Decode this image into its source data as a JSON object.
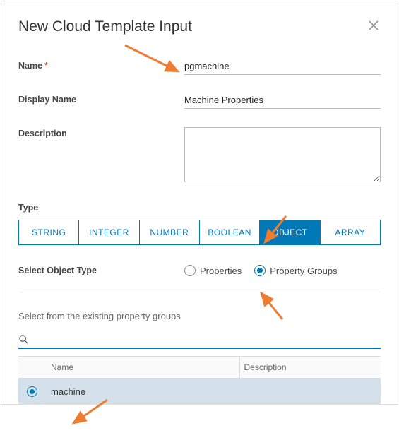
{
  "dialog": {
    "title": "New Cloud Template Input"
  },
  "form": {
    "name_label": "Name",
    "name_value": "pgmachine",
    "display_name_label": "Display Name",
    "display_name_value": "Machine Properties",
    "description_label": "Description",
    "description_value": ""
  },
  "type": {
    "label": "Type",
    "options": [
      "STRING",
      "INTEGER",
      "NUMBER",
      "BOOLEAN",
      "OBJECT",
      "ARRAY"
    ],
    "selected": "OBJECT"
  },
  "object_type": {
    "label": "Select Object Type",
    "options": [
      {
        "label": "Properties",
        "selected": false
      },
      {
        "label": "Property Groups",
        "selected": true
      }
    ]
  },
  "property_groups": {
    "section_label": "Select from the existing property groups",
    "search_value": "",
    "columns": {
      "name": "Name",
      "description": "Description"
    },
    "rows": [
      {
        "name": "machine",
        "description": "",
        "selected": true
      }
    ]
  }
}
